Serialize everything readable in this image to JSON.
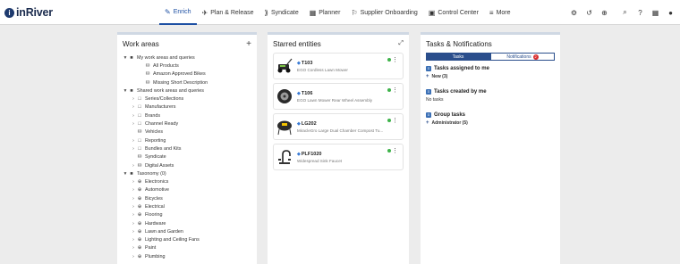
{
  "app": {
    "logo": "inRiver"
  },
  "nav": [
    {
      "label": "Enrich",
      "icon": "✎",
      "active": true
    },
    {
      "label": "Plan & Release",
      "icon": "✈"
    },
    {
      "label": "Syndicate",
      "icon": "⟫"
    },
    {
      "label": "Planner",
      "icon": "▦"
    },
    {
      "label": "Supplier Onboarding",
      "icon": "⚐"
    },
    {
      "label": "Control Center",
      "icon": "▣"
    },
    {
      "label": "More",
      "icon": "≡"
    }
  ],
  "tools": [
    {
      "name": "settings-tool-icon",
      "glyph": "⚙"
    },
    {
      "name": "history-icon",
      "glyph": "↺"
    },
    {
      "name": "zoom-search-icon",
      "glyph": "⊕"
    },
    {
      "name": "search-icon",
      "glyph": "⌕"
    },
    {
      "name": "help-icon",
      "glyph": "?"
    },
    {
      "name": "app-grid-icon",
      "glyph": "▦"
    },
    {
      "name": "user-icon",
      "glyph": "●"
    }
  ],
  "work_areas": {
    "title": "Work areas",
    "add": "+",
    "rows": [
      {
        "label": "My work areas and queries",
        "level": 1,
        "toggle": "▼",
        "icon": "■"
      },
      {
        "label": "All Products",
        "level": 3,
        "toggle": "",
        "icon": "⛁"
      },
      {
        "label": "Amazon Approved Bikes",
        "level": 3,
        "toggle": "",
        "icon": "⛁"
      },
      {
        "label": "Missing Short Description",
        "level": 3,
        "toggle": "",
        "icon": "⛁"
      },
      {
        "label": "Shared work areas and queries",
        "level": 1,
        "toggle": "▼",
        "icon": "■"
      },
      {
        "label": "Series/Collections",
        "level": 2,
        "toggle": "›",
        "icon": "□"
      },
      {
        "label": "Manufacturers",
        "level": 2,
        "toggle": "›",
        "icon": "□"
      },
      {
        "label": "Brands",
        "level": 2,
        "toggle": "›",
        "icon": "□"
      },
      {
        "label": "Channel Ready",
        "level": 2,
        "toggle": "›",
        "icon": "□"
      },
      {
        "label": "Vehicles",
        "level": 2,
        "toggle": "",
        "icon": "⛁"
      },
      {
        "label": "Reporting",
        "level": 2,
        "toggle": "›",
        "icon": "□"
      },
      {
        "label": "Bundles and Kits",
        "level": 2,
        "toggle": "›",
        "icon": "□"
      },
      {
        "label": "Syndicate",
        "level": 2,
        "toggle": "",
        "icon": "⛁"
      },
      {
        "label": "Digital Assets",
        "level": 2,
        "toggle": "›",
        "icon": "⛁"
      },
      {
        "label": "Taxonomy (0)",
        "level": 1,
        "toggle": "▼",
        "icon": "■"
      },
      {
        "label": "Electronics",
        "level": 2,
        "toggle": "›",
        "icon": "⊕"
      },
      {
        "label": "Automotive",
        "level": 2,
        "toggle": "›",
        "icon": "⊕"
      },
      {
        "label": "Bicycles",
        "level": 2,
        "toggle": "›",
        "icon": "⊕"
      },
      {
        "label": "Electrical",
        "level": 2,
        "toggle": "›",
        "icon": "⊕"
      },
      {
        "label": "Flooring",
        "level": 2,
        "toggle": "›",
        "icon": "⊕"
      },
      {
        "label": "Hardware",
        "level": 2,
        "toggle": "›",
        "icon": "⊕"
      },
      {
        "label": "Lawn and Garden",
        "level": 2,
        "toggle": "›",
        "icon": "⊕"
      },
      {
        "label": "Lighting and Ceiling Fans",
        "level": 2,
        "toggle": "›",
        "icon": "⊕"
      },
      {
        "label": "Paint",
        "level": 2,
        "toggle": "›",
        "icon": "⊕"
      },
      {
        "label": "Plumbing",
        "level": 2,
        "toggle": "›",
        "icon": "⊕"
      }
    ]
  },
  "starred": {
    "title": "Starred entities",
    "expand": "⤢",
    "items": [
      {
        "id": "T103",
        "desc": "EGO Cordless Lawn Mower",
        "thumb": "mower"
      },
      {
        "id": "T106",
        "desc": "EGO Lawn Mower Rear Wheel Assembly",
        "thumb": "wheel"
      },
      {
        "id": "LG202",
        "desc": "MiracleGro Large Dual Chamber Compost Tu...",
        "thumb": "composter"
      },
      {
        "id": "PLF1020",
        "desc": "Widespread Sink Faucet",
        "thumb": "faucet"
      }
    ]
  },
  "tasks": {
    "title": "Tasks & Notifications",
    "tab_tasks": "Tasks",
    "tab_notifications": "Notifications",
    "notif_count": "2",
    "assigned_title": "Tasks assigned to me",
    "assigned_line": "New (3)",
    "created_title": "Tasks created by me",
    "created_line": "No tasks",
    "group_title": "Group tasks",
    "group_line": "Administrator (5)"
  },
  "colors": {
    "accent": "#1d4fa3",
    "tab": "#2a4e8c",
    "ok": "#3eb34a",
    "badge": "#d92c2c"
  }
}
